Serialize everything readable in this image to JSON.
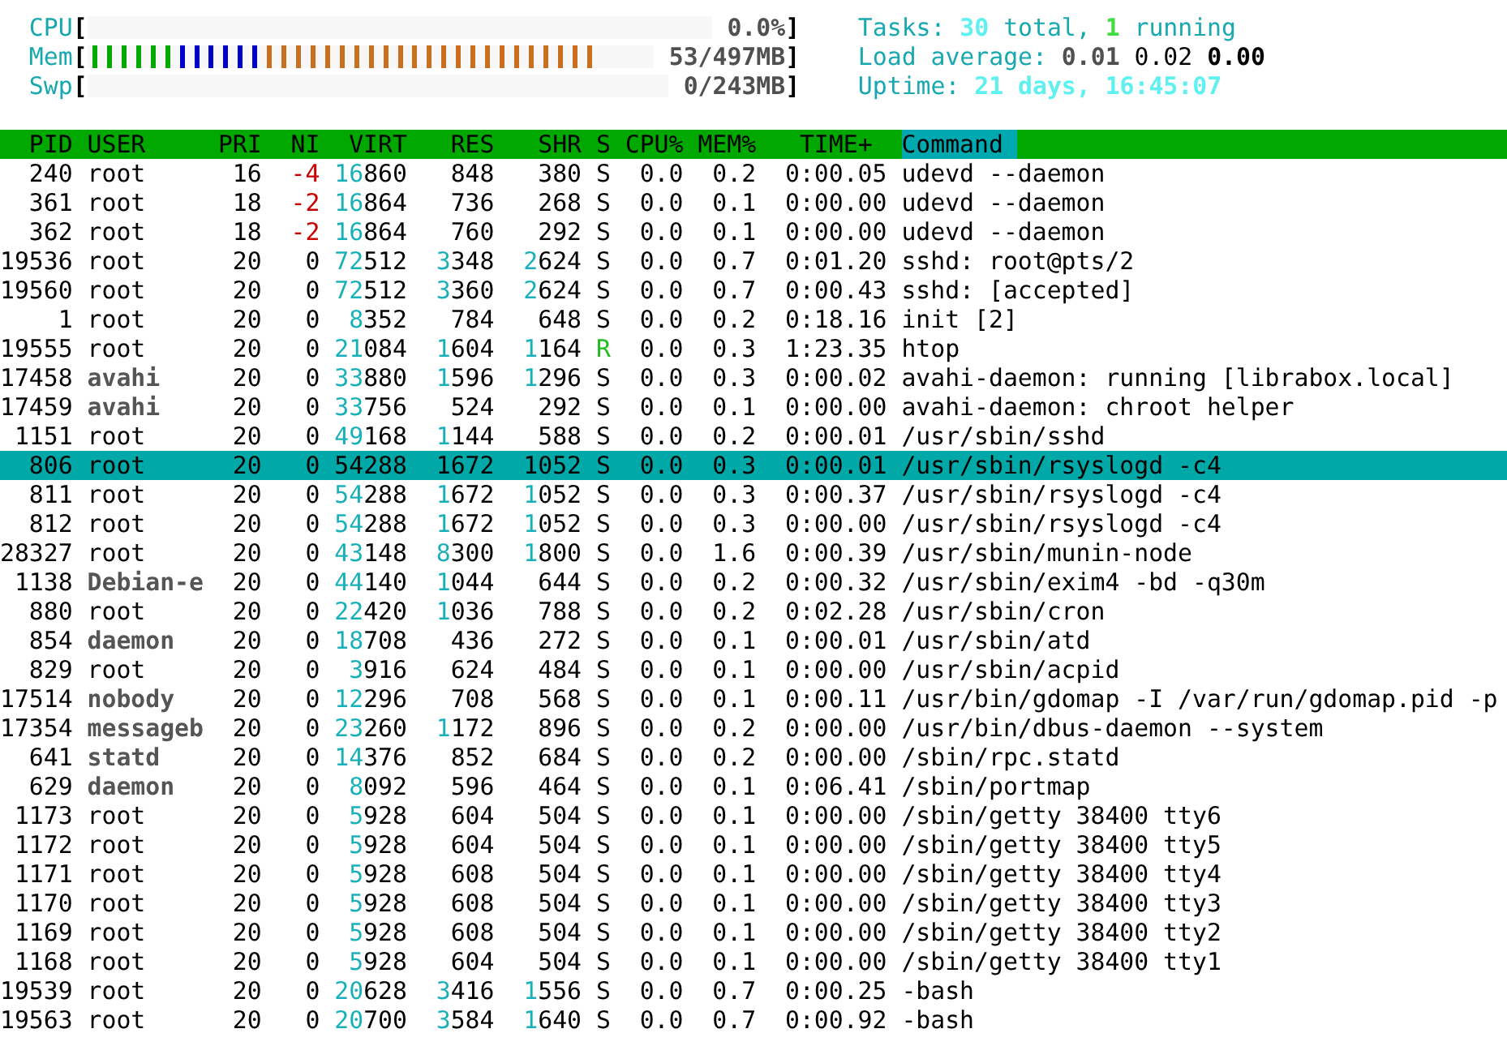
{
  "meters": [
    {
      "label": "CPU",
      "open_bracket": "[",
      "reading": "0.0%",
      "close_bracket": "]"
    },
    {
      "label": "Mem",
      "open_bracket": "[",
      "reading": "53/497MB",
      "close_bracket": "]",
      "segments": [
        {
          "level": 0.158,
          "color": "#00aa00"
        },
        {
          "level": 0.316,
          "color": "#0000cc"
        },
        {
          "level": 0.896,
          "color": "#c87020"
        }
      ]
    },
    {
      "label": "Swp",
      "open_bracket": "[",
      "reading": "0/243MB",
      "close_bracket": "]"
    }
  ],
  "summary": [
    [
      {
        "text": "Tasks:",
        "kind": "label"
      },
      {
        "text": "30",
        "kind": "value"
      },
      {
        "text": "total,",
        "kind": "label"
      },
      {
        "text": "1",
        "kind": "running"
      },
      {
        "text": "running",
        "kind": "label"
      }
    ],
    [
      {
        "text": "Load average:",
        "kind": "label"
      },
      {
        "text": "0.01",
        "kind": "dim"
      },
      {
        "text": "0.02",
        "kind": "normal"
      },
      {
        "text": "0.00",
        "kind": "strong"
      }
    ],
    [
      {
        "text": "Uptime:",
        "kind": "label"
      },
      {
        "text": "21 days, 16:45:07",
        "kind": "value"
      }
    ]
  ],
  "columns": [
    {
      "label": "PID",
      "sorted": false
    },
    {
      "label": "USER",
      "sorted": false
    },
    {
      "label": "PRI",
      "sorted": false
    },
    {
      "label": "NI",
      "sorted": false
    },
    {
      "label": "VIRT",
      "sorted": false
    },
    {
      "label": "RES",
      "sorted": false
    },
    {
      "label": "SHR",
      "sorted": false
    },
    {
      "label": "S",
      "sorted": false
    },
    {
      "label": "CPU%",
      "sorted": false
    },
    {
      "label": "MEM%",
      "sorted": false
    },
    {
      "label": "TIME+",
      "sorted": false
    },
    {
      "label": "Command",
      "sorted": true
    }
  ],
  "rows": [
    {
      "pid": "240",
      "user": "root",
      "user_dim": false,
      "pri": "16",
      "ni": "-4",
      "ni_negative": true,
      "virt": "16860",
      "res": "848",
      "shr": "380",
      "state": "S",
      "running": false,
      "cpu": "0.0",
      "mem": "0.2",
      "time": "0:00.05",
      "command": "udevd --daemon",
      "selected": false
    },
    {
      "pid": "361",
      "user": "root",
      "user_dim": false,
      "pri": "18",
      "ni": "-2",
      "ni_negative": true,
      "virt": "16864",
      "res": "736",
      "shr": "268",
      "state": "S",
      "running": false,
      "cpu": "0.0",
      "mem": "0.1",
      "time": "0:00.00",
      "command": "udevd --daemon",
      "selected": false
    },
    {
      "pid": "362",
      "user": "root",
      "user_dim": false,
      "pri": "18",
      "ni": "-2",
      "ni_negative": true,
      "virt": "16864",
      "res": "760",
      "shr": "292",
      "state": "S",
      "running": false,
      "cpu": "0.0",
      "mem": "0.1",
      "time": "0:00.00",
      "command": "udevd --daemon",
      "selected": false
    },
    {
      "pid": "19536",
      "user": "root",
      "user_dim": false,
      "pri": "20",
      "ni": "0",
      "ni_negative": false,
      "virt": "72512",
      "res": "3348",
      "shr": "2624",
      "state": "S",
      "running": false,
      "cpu": "0.0",
      "mem": "0.7",
      "time": "0:01.20",
      "command": "sshd: root@pts/2",
      "selected": false
    },
    {
      "pid": "19560",
      "user": "root",
      "user_dim": false,
      "pri": "20",
      "ni": "0",
      "ni_negative": false,
      "virt": "72512",
      "res": "3360",
      "shr": "2624",
      "state": "S",
      "running": false,
      "cpu": "0.0",
      "mem": "0.7",
      "time": "0:00.43",
      "command": "sshd: [accepted]",
      "selected": false
    },
    {
      "pid": "1",
      "user": "root",
      "user_dim": false,
      "pri": "20",
      "ni": "0",
      "ni_negative": false,
      "virt": "8352",
      "res": "784",
      "shr": "648",
      "state": "S",
      "running": false,
      "cpu": "0.0",
      "mem": "0.2",
      "time": "0:18.16",
      "command": "init [2]",
      "selected": false
    },
    {
      "pid": "19555",
      "user": "root",
      "user_dim": false,
      "pri": "20",
      "ni": "0",
      "ni_negative": false,
      "virt": "21084",
      "res": "1604",
      "shr": "1164",
      "state": "R",
      "running": true,
      "cpu": "0.0",
      "mem": "0.3",
      "time": "1:23.35",
      "command": "htop",
      "selected": false
    },
    {
      "pid": "17458",
      "user": "avahi",
      "user_dim": true,
      "pri": "20",
      "ni": "0",
      "ni_negative": false,
      "virt": "33880",
      "res": "1596",
      "shr": "1296",
      "state": "S",
      "running": false,
      "cpu": "0.0",
      "mem": "0.3",
      "time": "0:00.02",
      "command": "avahi-daemon: running [librabox.local]",
      "selected": false
    },
    {
      "pid": "17459",
      "user": "avahi",
      "user_dim": true,
      "pri": "20",
      "ni": "0",
      "ni_negative": false,
      "virt": "33756",
      "res": "524",
      "shr": "292",
      "state": "S",
      "running": false,
      "cpu": "0.0",
      "mem": "0.1",
      "time": "0:00.00",
      "command": "avahi-daemon: chroot helper",
      "selected": false
    },
    {
      "pid": "1151",
      "user": "root",
      "user_dim": false,
      "pri": "20",
      "ni": "0",
      "ni_negative": false,
      "virt": "49168",
      "res": "1144",
      "shr": "588",
      "state": "S",
      "running": false,
      "cpu": "0.0",
      "mem": "0.2",
      "time": "0:00.01",
      "command": "/usr/sbin/sshd",
      "selected": false
    },
    {
      "pid": "806",
      "user": "root",
      "user_dim": false,
      "pri": "20",
      "ni": "0",
      "ni_negative": false,
      "virt": "54288",
      "res": "1672",
      "shr": "1052",
      "state": "S",
      "running": false,
      "cpu": "0.0",
      "mem": "0.3",
      "time": "0:00.01",
      "command": "/usr/sbin/rsyslogd -c4",
      "selected": true
    },
    {
      "pid": "811",
      "user": "root",
      "user_dim": false,
      "pri": "20",
      "ni": "0",
      "ni_negative": false,
      "virt": "54288",
      "res": "1672",
      "shr": "1052",
      "state": "S",
      "running": false,
      "cpu": "0.0",
      "mem": "0.3",
      "time": "0:00.37",
      "command": "/usr/sbin/rsyslogd -c4",
      "selected": false
    },
    {
      "pid": "812",
      "user": "root",
      "user_dim": false,
      "pri": "20",
      "ni": "0",
      "ni_negative": false,
      "virt": "54288",
      "res": "1672",
      "shr": "1052",
      "state": "S",
      "running": false,
      "cpu": "0.0",
      "mem": "0.3",
      "time": "0:00.00",
      "command": "/usr/sbin/rsyslogd -c4",
      "selected": false
    },
    {
      "pid": "28327",
      "user": "root",
      "user_dim": false,
      "pri": "20",
      "ni": "0",
      "ni_negative": false,
      "virt": "43148",
      "res": "8300",
      "shr": "1800",
      "state": "S",
      "running": false,
      "cpu": "0.0",
      "mem": "1.6",
      "time": "0:00.39",
      "command": "/usr/sbin/munin-node",
      "selected": false
    },
    {
      "pid": "1138",
      "user": "Debian-e",
      "user_dim": true,
      "pri": "20",
      "ni": "0",
      "ni_negative": false,
      "virt": "44140",
      "res": "1044",
      "shr": "644",
      "state": "S",
      "running": false,
      "cpu": "0.0",
      "mem": "0.2",
      "time": "0:00.32",
      "command": "/usr/sbin/exim4 -bd -q30m",
      "selected": false
    },
    {
      "pid": "880",
      "user": "root",
      "user_dim": false,
      "pri": "20",
      "ni": "0",
      "ni_negative": false,
      "virt": "22420",
      "res": "1036",
      "shr": "788",
      "state": "S",
      "running": false,
      "cpu": "0.0",
      "mem": "0.2",
      "time": "0:02.28",
      "command": "/usr/sbin/cron",
      "selected": false
    },
    {
      "pid": "854",
      "user": "daemon",
      "user_dim": true,
      "pri": "20",
      "ni": "0",
      "ni_negative": false,
      "virt": "18708",
      "res": "436",
      "shr": "272",
      "state": "S",
      "running": false,
      "cpu": "0.0",
      "mem": "0.1",
      "time": "0:00.01",
      "command": "/usr/sbin/atd",
      "selected": false
    },
    {
      "pid": "829",
      "user": "root",
      "user_dim": false,
      "pri": "20",
      "ni": "0",
      "ni_negative": false,
      "virt": "3916",
      "res": "624",
      "shr": "484",
      "state": "S",
      "running": false,
      "cpu": "0.0",
      "mem": "0.1",
      "time": "0:00.00",
      "command": "/usr/sbin/acpid",
      "selected": false
    },
    {
      "pid": "17514",
      "user": "nobody",
      "user_dim": true,
      "pri": "20",
      "ni": "0",
      "ni_negative": false,
      "virt": "12296",
      "res": "708",
      "shr": "568",
      "state": "S",
      "running": false,
      "cpu": "0.0",
      "mem": "0.1",
      "time": "0:00.11",
      "command": "/usr/bin/gdomap -I /var/run/gdomap.pid -p",
      "selected": false
    },
    {
      "pid": "17354",
      "user": "messageb",
      "user_dim": true,
      "pri": "20",
      "ni": "0",
      "ni_negative": false,
      "virt": "23260",
      "res": "1172",
      "shr": "896",
      "state": "S",
      "running": false,
      "cpu": "0.0",
      "mem": "0.2",
      "time": "0:00.00",
      "command": "/usr/bin/dbus-daemon --system",
      "selected": false
    },
    {
      "pid": "641",
      "user": "statd",
      "user_dim": true,
      "pri": "20",
      "ni": "0",
      "ni_negative": false,
      "virt": "14376",
      "res": "852",
      "shr": "684",
      "state": "S",
      "running": false,
      "cpu": "0.0",
      "mem": "0.2",
      "time": "0:00.00",
      "command": "/sbin/rpc.statd",
      "selected": false
    },
    {
      "pid": "629",
      "user": "daemon",
      "user_dim": true,
      "pri": "20",
      "ni": "0",
      "ni_negative": false,
      "virt": "8092",
      "res": "596",
      "shr": "464",
      "state": "S",
      "running": false,
      "cpu": "0.0",
      "mem": "0.1",
      "time": "0:06.41",
      "command": "/sbin/portmap",
      "selected": false
    },
    {
      "pid": "1173",
      "user": "root",
      "user_dim": false,
      "pri": "20",
      "ni": "0",
      "ni_negative": false,
      "virt": "5928",
      "res": "604",
      "shr": "504",
      "state": "S",
      "running": false,
      "cpu": "0.0",
      "mem": "0.1",
      "time": "0:00.00",
      "command": "/sbin/getty 38400 tty6",
      "selected": false
    },
    {
      "pid": "1172",
      "user": "root",
      "user_dim": false,
      "pri": "20",
      "ni": "0",
      "ni_negative": false,
      "virt": "5928",
      "res": "604",
      "shr": "504",
      "state": "S",
      "running": false,
      "cpu": "0.0",
      "mem": "0.1",
      "time": "0:00.00",
      "command": "/sbin/getty 38400 tty5",
      "selected": false
    },
    {
      "pid": "1171",
      "user": "root",
      "user_dim": false,
      "pri": "20",
      "ni": "0",
      "ni_negative": false,
      "virt": "5928",
      "res": "608",
      "shr": "504",
      "state": "S",
      "running": false,
      "cpu": "0.0",
      "mem": "0.1",
      "time": "0:00.00",
      "command": "/sbin/getty 38400 tty4",
      "selected": false
    },
    {
      "pid": "1170",
      "user": "root",
      "user_dim": false,
      "pri": "20",
      "ni": "0",
      "ni_negative": false,
      "virt": "5928",
      "res": "608",
      "shr": "504",
      "state": "S",
      "running": false,
      "cpu": "0.0",
      "mem": "0.1",
      "time": "0:00.00",
      "command": "/sbin/getty 38400 tty3",
      "selected": false
    },
    {
      "pid": "1169",
      "user": "root",
      "user_dim": false,
      "pri": "20",
      "ni": "0",
      "ni_negative": false,
      "virt": "5928",
      "res": "608",
      "shr": "504",
      "state": "S",
      "running": false,
      "cpu": "0.0",
      "mem": "0.1",
      "time": "0:00.00",
      "command": "/sbin/getty 38400 tty2",
      "selected": false
    },
    {
      "pid": "1168",
      "user": "root",
      "user_dim": false,
      "pri": "20",
      "ni": "0",
      "ni_negative": false,
      "virt": "5928",
      "res": "604",
      "shr": "504",
      "state": "S",
      "running": false,
      "cpu": "0.0",
      "mem": "0.1",
      "time": "0:00.00",
      "command": "/sbin/getty 38400 tty1",
      "selected": false
    },
    {
      "pid": "19539",
      "user": "root",
      "user_dim": false,
      "pri": "20",
      "ni": "0",
      "ni_negative": false,
      "virt": "20628",
      "res": "3416",
      "shr": "1556",
      "state": "S",
      "running": false,
      "cpu": "0.0",
      "mem": "0.7",
      "time": "0:00.25",
      "command": "-bash",
      "selected": false
    },
    {
      "pid": "19563",
      "user": "root",
      "user_dim": false,
      "pri": "20",
      "ni": "0",
      "ni_negative": false,
      "virt": "20700",
      "res": "3584",
      "shr": "1640",
      "state": "S",
      "running": false,
      "cpu": "0.0",
      "mem": "0.7",
      "time": "0:00.92",
      "command": "-bash",
      "selected": false
    }
  ]
}
